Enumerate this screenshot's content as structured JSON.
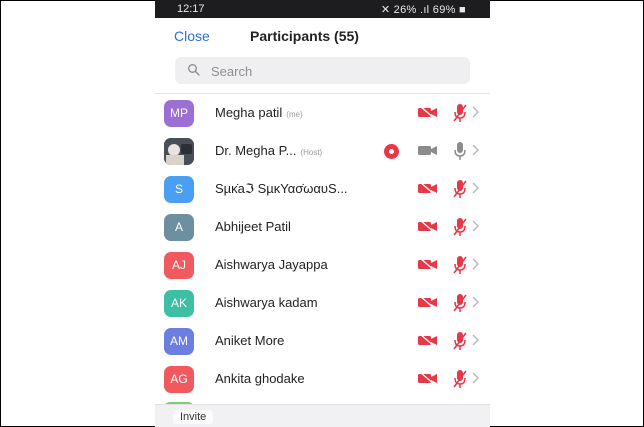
{
  "status_bar": {
    "time": "12:17",
    "system": "✕ 26% .ıl 69% ■"
  },
  "header": {
    "close_label": "Close",
    "title": "Participants (55)"
  },
  "search": {
    "placeholder": "Search"
  },
  "participants": [
    {
      "initials": "MP",
      "name": "Megha patil",
      "tag": "(me)",
      "avatar_color": "#9b6fd4",
      "photo": false,
      "recording": false,
      "video": "off",
      "audio": "muted"
    },
    {
      "initials": "",
      "name": "Dr. Megha P...",
      "tag": "(Host)",
      "avatar_color": "#4a4e57",
      "photo": true,
      "recording": true,
      "video": "off-grey",
      "audio": "unmuted"
    },
    {
      "initials": "S",
      "name": "Sµκ̇aℑ SµκΥασ̇ωαυS...",
      "tag": "",
      "avatar_color": "#4a9ff2",
      "photo": false,
      "recording": false,
      "video": "off",
      "audio": "muted"
    },
    {
      "initials": "A",
      "name": "Abhijeet Patil",
      "tag": "",
      "avatar_color": "#6d8fa0",
      "photo": false,
      "recording": false,
      "video": "off",
      "audio": "muted"
    },
    {
      "initials": "AJ",
      "name": "Aishwarya Jayappa",
      "tag": "",
      "avatar_color": "#f0595e",
      "photo": false,
      "recording": false,
      "video": "off",
      "audio": "muted"
    },
    {
      "initials": "AK",
      "name": "Aishwarya kadam",
      "tag": "",
      "avatar_color": "#3dbfa3",
      "photo": false,
      "recording": false,
      "video": "off",
      "audio": "muted"
    },
    {
      "initials": "AM",
      "name": "Aniket More",
      "tag": "",
      "avatar_color": "#6c7fe0",
      "photo": false,
      "recording": false,
      "video": "off",
      "audio": "muted"
    },
    {
      "initials": "AG",
      "name": "Ankita ghodake",
      "tag": "",
      "avatar_color": "#f0595e",
      "photo": false,
      "recording": false,
      "video": "off",
      "audio": "muted"
    }
  ],
  "footer": {
    "invite_label": "Invite"
  },
  "colors": {
    "accent": "#2d6fd6",
    "muted_red": "#e5394a",
    "grey_icon": "#8c8c8c"
  }
}
